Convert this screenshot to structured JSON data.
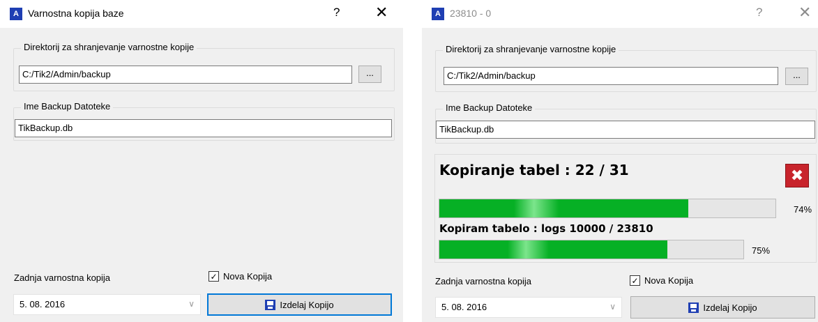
{
  "dialog_left": {
    "title": "Varnostna kopija baze",
    "app_icon_letter": "A",
    "help_glyph": "?",
    "close_glyph": "✕",
    "directory_group_label": "Direktorij za shranjevanje varnostne kopije",
    "directory_value": "C:/Tik2/Admin/backup",
    "browse_label": "...",
    "filename_group_label": "Ime Backup Datoteke",
    "filename_value": "TikBackup.db",
    "last_backup_label": "Zadnja varnostna kopija",
    "new_copy_label": "Nova Kopija",
    "new_copy_checked": true,
    "checkmark": "✓",
    "date_value": "5. 08. 2016",
    "chevron": "∨",
    "make_copy_label": "Izdelaj Kopijo"
  },
  "dialog_right": {
    "title": "23810 - 0",
    "app_icon_letter": "A",
    "help_glyph": "?",
    "close_glyph": "✕",
    "directory_group_label": "Direktorij za shranjevanje varnostne kopije",
    "directory_value": "C:/Tik2/Admin/backup",
    "browse_label": "...",
    "filename_group_label": "Ime Backup Datoteke",
    "filename_value": "TikBackup.db",
    "progress": {
      "heading": "Kopiranje tabel : 22 / 31",
      "cancel_glyph": "✖",
      "tables_fraction": 0.74,
      "tables_pct_label": "74%",
      "current_table_label": "Kopiram tabelo : logs 10000 / 23810",
      "rows_fraction": 0.75,
      "rows_pct_label": "75%"
    },
    "last_backup_label": "Zadnja varnostna kopija",
    "new_copy_label": "Nova Kopija",
    "new_copy_checked": true,
    "checkmark": "✓",
    "date_value": "5. 08. 2016",
    "chevron": "∨",
    "make_copy_label": "Izdelaj Kopijo"
  },
  "colors": {
    "progress_green": "#06b025",
    "cancel_red": "#c8242c",
    "focus_blue": "#0078d7",
    "app_icon_blue": "#1f3fb3"
  }
}
